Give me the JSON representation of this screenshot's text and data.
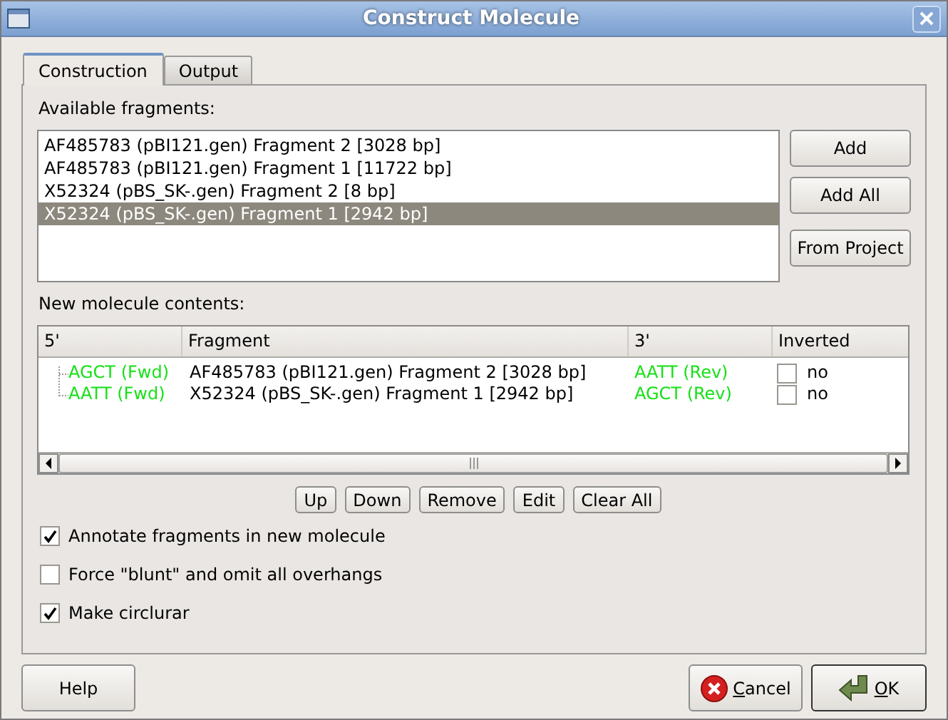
{
  "window": {
    "title": "Construct Molecule"
  },
  "tabs": [
    {
      "label": "Construction",
      "selected": true
    },
    {
      "label": "Output",
      "selected": false
    }
  ],
  "available": {
    "label": "Available fragments:",
    "items": [
      {
        "text": "AF485783 (pBI121.gen) Fragment 2 [3028 bp]",
        "selected": false
      },
      {
        "text": "AF485783 (pBI121.gen) Fragment 1 [11722 bp]",
        "selected": false
      },
      {
        "text": "X52324 (pBS_SK-.gen) Fragment 2 [8 bp]",
        "selected": false
      },
      {
        "text": "X52324 (pBS_SK-.gen) Fragment 1 [2942 bp]",
        "selected": true
      }
    ],
    "buttons": [
      "Add",
      "Add All",
      "From Project"
    ]
  },
  "contents": {
    "label": "New molecule contents:",
    "columns": [
      "5'",
      "Fragment",
      "3'",
      "Inverted"
    ],
    "rows": [
      {
        "five_prime": "AGCT (Fwd)",
        "fragment": "AF485783 (pBI121.gen) Fragment 2 [3028 bp]",
        "three_prime": "AATT (Rev)",
        "inverted": false,
        "inverted_text": "no"
      },
      {
        "five_prime": "AATT (Fwd)",
        "fragment": "X52324 (pBS_SK-.gen) Fragment 1 [2942 bp]",
        "three_prime": "AGCT (Rev)",
        "inverted": false,
        "inverted_text": "no"
      }
    ],
    "buttons": [
      "Up",
      "Down",
      "Remove",
      "Edit",
      "Clear All"
    ]
  },
  "options": [
    {
      "label": "Annotate fragments in new molecule",
      "checked": true
    },
    {
      "label": "Force \"blunt\" and omit all overhangs",
      "checked": false
    },
    {
      "label": "Make circlurar",
      "checked": true
    }
  ],
  "buttons": [
    {
      "kind": "help",
      "label": "Help"
    },
    {
      "kind": "cancel",
      "label": "Cancel"
    },
    {
      "kind": "ok",
      "label": "OK"
    }
  ]
}
